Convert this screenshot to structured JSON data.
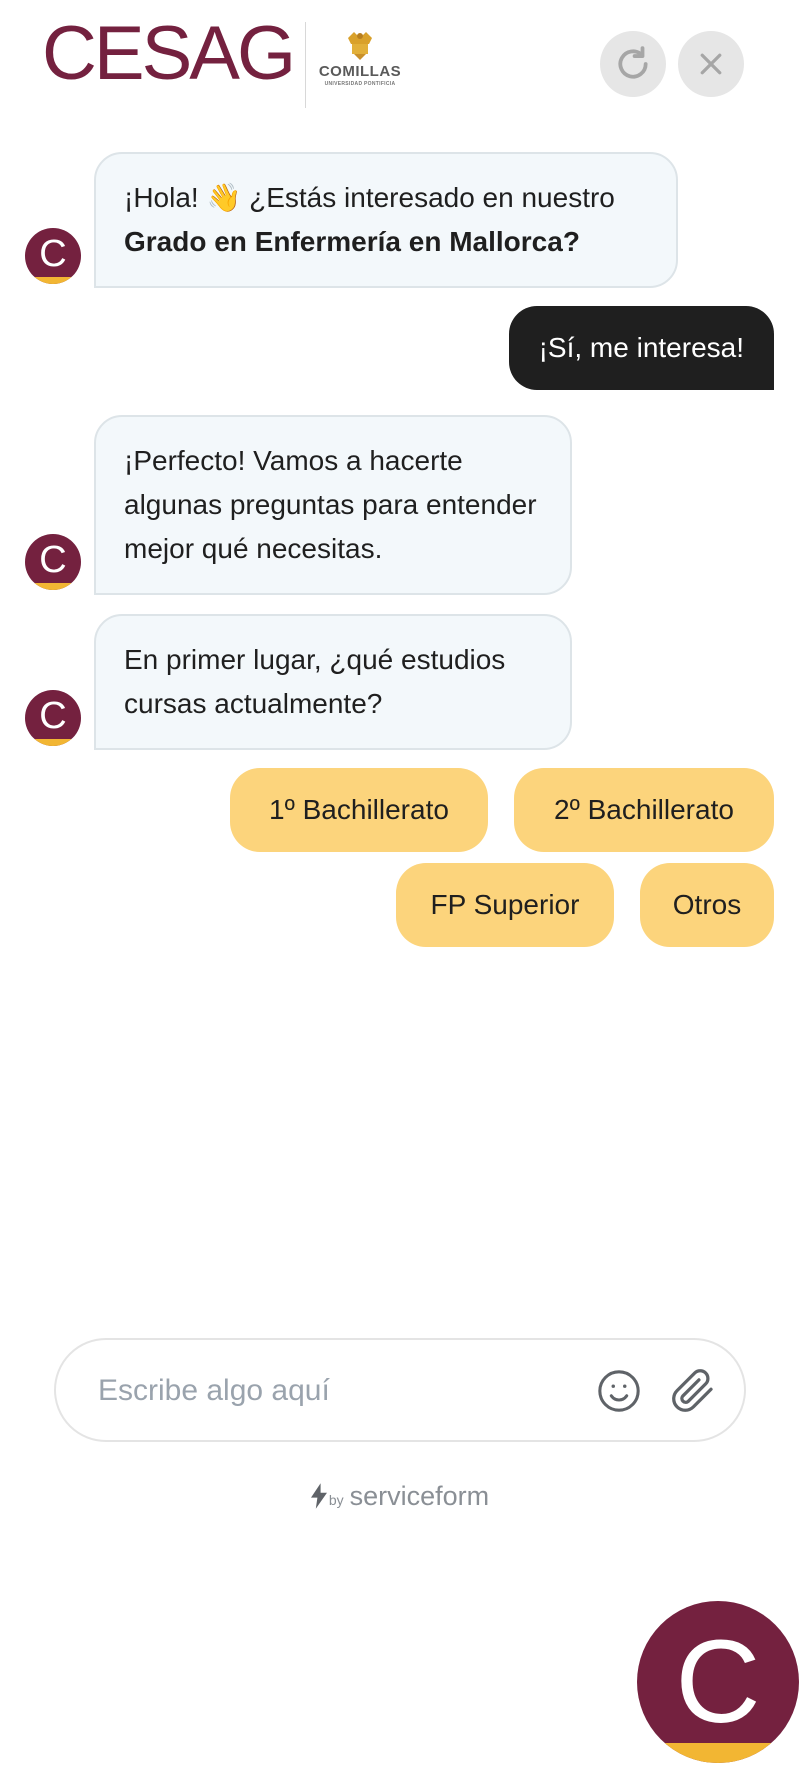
{
  "header": {
    "logo_text": "CESAG",
    "partner_name": "COMILLAS",
    "partner_subtitle": "UNIVERSIDAD PONTIFICIA",
    "brand_color": "#74213f",
    "accent_color": "#f2b633"
  },
  "avatar_letter": "C",
  "messages": {
    "bot_1_line1": "¡Hola! 👋 ¿Estás interesado en nuestro",
    "bot_1_line2_bold": "Grado en Enfermería en Mallorca?",
    "user_1": "¡Sí, me interesa!",
    "bot_2": "¡Perfecto! Vamos a hacerte algunas preguntas para entender mejor qué necesitas.",
    "bot_3": "En primer lugar, ¿qué estudios cursas actualmente?"
  },
  "quick_replies": [
    "1º Bachillerato",
    "2º Bachillerato",
    "FP Superior",
    "Otros"
  ],
  "input": {
    "placeholder": "Escribe algo aquí"
  },
  "footer": {
    "by_label": "by",
    "brand": "serviceform"
  },
  "icons": {
    "refresh": "refresh-icon",
    "close": "close-icon",
    "emoji": "smiley-icon",
    "attach": "paperclip-icon",
    "bolt": "bolt-icon"
  }
}
